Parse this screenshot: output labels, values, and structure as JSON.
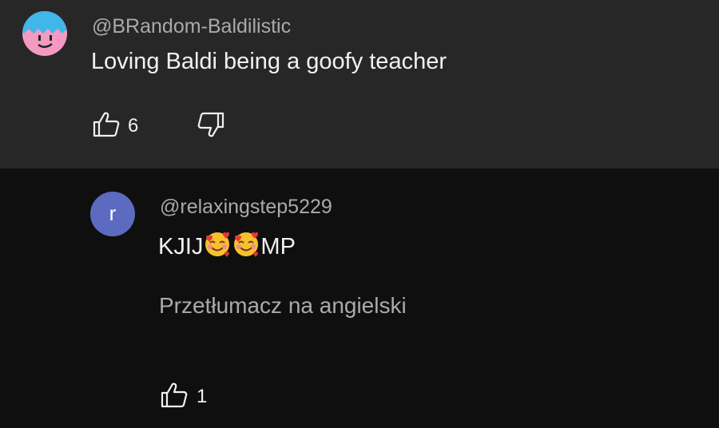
{
  "comment": {
    "handle": "@BRandom-Baldilistic",
    "text": "Loving Baldi being a goofy teacher",
    "like_count": "6",
    "avatar_icon": "smiley-face-avatar"
  },
  "reply": {
    "avatar_letter": "r",
    "avatar_color": "#5c6bc0",
    "handle": "@relaxingstep5229",
    "text_before": "KJIJ",
    "emoji": [
      "smiling-face-with-hearts-icon",
      "smiling-face-with-hearts-icon"
    ],
    "text_after": "MP",
    "translate_label": "Przetłumacz na angielski",
    "like_count": "1"
  },
  "colors": {
    "top_background": "#272727",
    "page_background": "#0f0f0f",
    "primary_text": "#f1f1f1",
    "secondary_text": "#aaaaaa"
  }
}
